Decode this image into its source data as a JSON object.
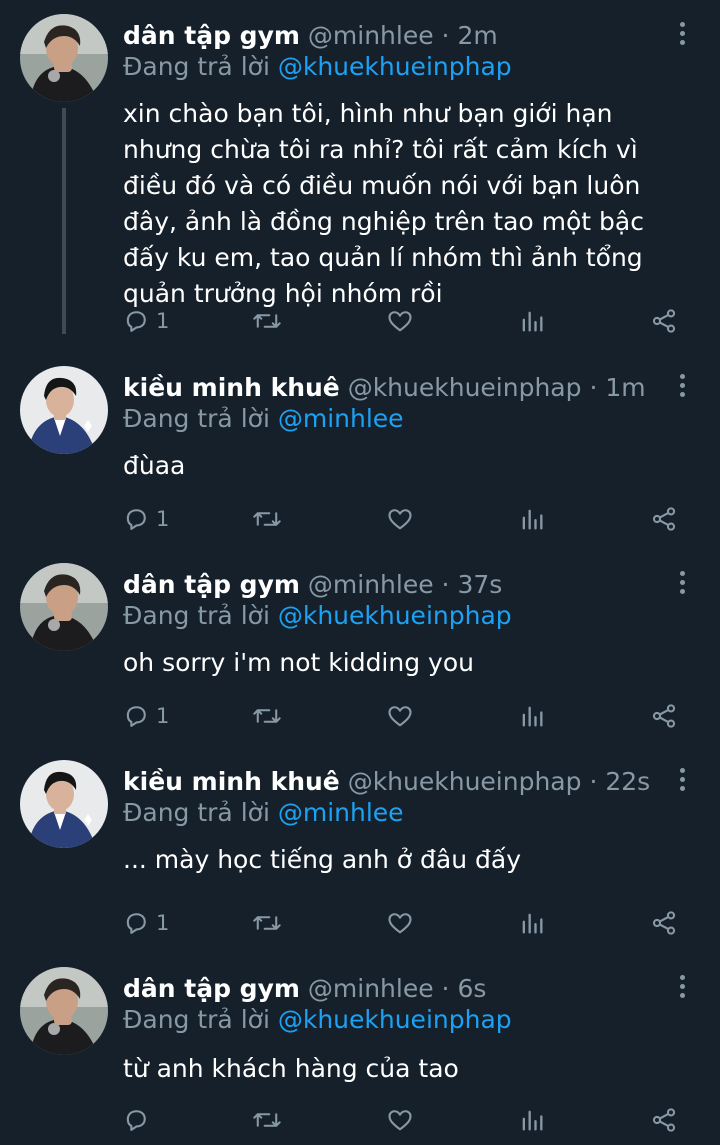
{
  "users": {
    "minhlee": {
      "display_name": "dân tập gym",
      "handle": "@minhlee"
    },
    "khue": {
      "display_name": "kiều minh khuê",
      "handle": "@khuekhueinphap"
    }
  },
  "reply_prefix": "Đang trả lời",
  "tweets": [
    {
      "display_name": "dân tập gym",
      "handle": "@minhlee",
      "time": "2m",
      "reply_to": "@khuekhueinphap",
      "text": "xin chào bạn tôi, hình như bạn giới hạn nhưng chừa tôi ra nhỉ? tôi rất cảm kích vì điều đó và có điều muốn nói với bạn luôn đây, ảnh là đồng nghiệp trên tao một bậc đấy ku em, tao quản lí nhóm thì ảnh tổng quản trưởng hội nhóm rồi",
      "reply_count": "1"
    },
    {
      "display_name": "kiều minh khuê",
      "handle": "@khuekhueinphap",
      "time": "1m",
      "reply_to": "@minhlee",
      "text": "đùaa",
      "reply_count": "1"
    },
    {
      "display_name": "dân tập gym",
      "handle": "@minhlee",
      "time": "37s",
      "reply_to": "@khuekhueinphap",
      "text": "oh sorry i'm not kidding you",
      "reply_count": "1"
    },
    {
      "display_name": "kiều minh khuê",
      "handle": "@khuekhueinphap",
      "time": "22s",
      "reply_to": "@minhlee",
      "text": "... mày học tiếng anh ở đâu đấy",
      "reply_count": "1"
    },
    {
      "display_name": "dân tập gym",
      "handle": "@minhlee",
      "time": "6s",
      "reply_to": "@khuekhueinphap",
      "text": "từ anh khách hàng của tao",
      "reply_count": ""
    }
  ],
  "icons": {
    "reply": "reply-icon",
    "retweet": "retweet-icon",
    "like": "heart-icon",
    "analytics": "analytics-icon",
    "share": "share-icon",
    "more": "more-vertical-icon"
  },
  "colors": {
    "background": "#15202b",
    "secondary_text": "#8899a6",
    "mention": "#1da1f2",
    "thread_line": "#3d4b57"
  }
}
